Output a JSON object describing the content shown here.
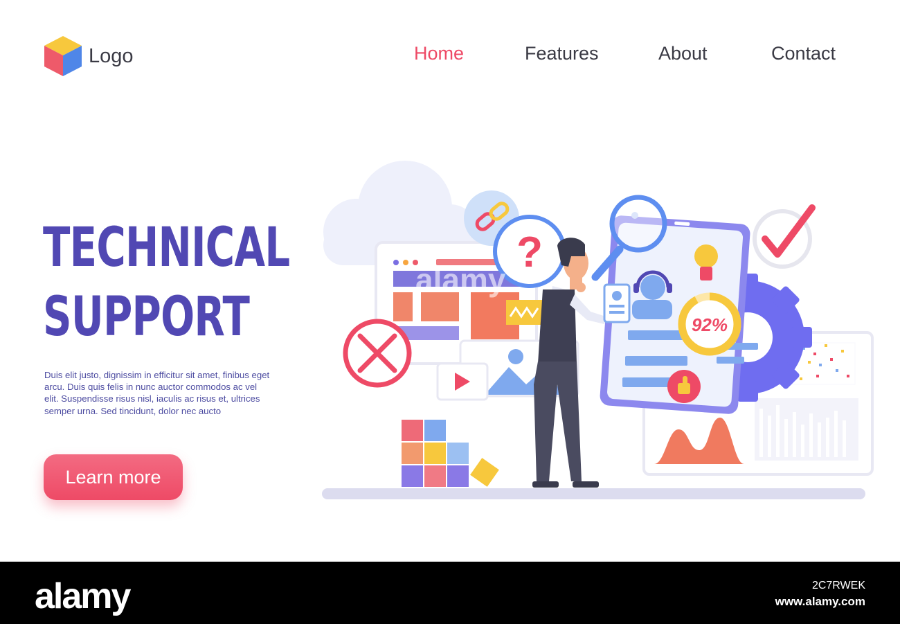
{
  "header": {
    "logo_label": "Logo",
    "nav": [
      {
        "label": "Home",
        "active": true
      },
      {
        "label": "Features",
        "active": false
      },
      {
        "label": "About",
        "active": false
      },
      {
        "label": "Contact",
        "active": false
      }
    ]
  },
  "hero": {
    "title_line1": "TECHNICAL",
    "title_line2": "SUPPORT",
    "description": "Duis elit justo, dignissim in efficitur sit amet, finibus eget arcu. Duis quis felis in nunc auctor commodos ac vel elit. Suspendisse risus nisl, iaculis ac risus et, ultrices semper urna. Sed tincidunt, dolor nec aucto",
    "cta_label": "Learn more"
  },
  "illustration": {
    "progress_label": "92%",
    "progress_value": 0.92,
    "question_mark": "?",
    "watermark": "alamy"
  },
  "footer": {
    "brand": "alamy",
    "image_id": "2C7RWEK",
    "site": "www.alamy.com"
  },
  "colors": {
    "accent": "#ee4a66",
    "title": "#5148b3",
    "text": "#3a3a44",
    "footer_bg": "#000000"
  },
  "icons": [
    "cube-logo-icon",
    "cloud-icon",
    "link-icon",
    "question-icon",
    "magnifier-icon",
    "checkmark-icon",
    "cancel-icon",
    "play-icon",
    "image-icon",
    "gear-icon",
    "headset-agent-icon",
    "lightbulb-icon",
    "thumbs-up-icon"
  ]
}
